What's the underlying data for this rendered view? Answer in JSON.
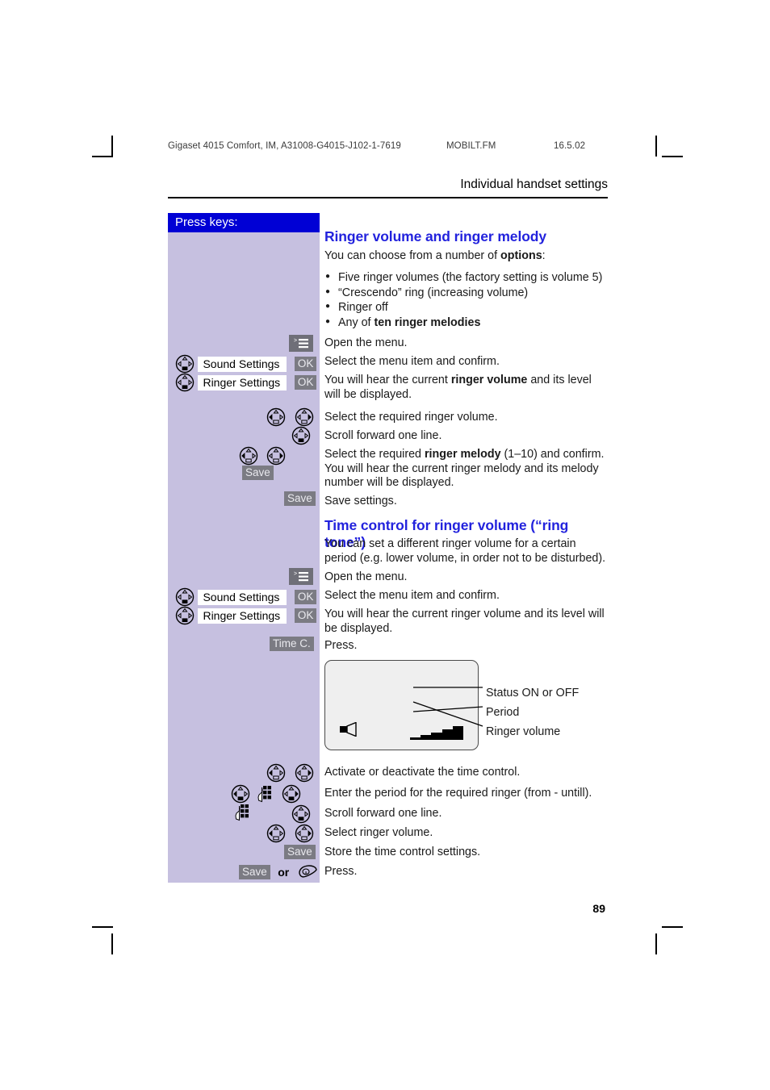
{
  "header": {
    "document_id": "Gigaset 4015 Comfort, IM, A31008-G4015-J102-1-7619",
    "file_name": "MOBILT.FM",
    "date": "16.5.02",
    "chapter_title": "Individual handset settings"
  },
  "sidebar": {
    "title": "Press keys:",
    "labels": {
      "sound_settings": "Sound Settings",
      "ringer_settings": "Ringer Settings",
      "ok": "OK",
      "save": "Save",
      "time_c": "Time C.",
      "or": "or"
    }
  },
  "sections": [
    {
      "heading": "Ringer volume and ringer melody",
      "intro_pre": "You can choose from a number of ",
      "intro_bold": "options",
      "intro_post": ":",
      "options": [
        {
          "pre": "Five ringer volumes (the factory setting is volume 5)",
          "bold": "",
          "post": ""
        },
        {
          "pre": "“Crescendo” ring (increasing volume)",
          "bold": "",
          "post": ""
        },
        {
          "pre": "Ringer off",
          "bold": "",
          "post": ""
        },
        {
          "pre": "Any of ",
          "bold": "ten ringer melodies",
          "post": ""
        }
      ],
      "steps": [
        {
          "pre": "Open the menu.",
          "bold": "",
          "post": ""
        },
        {
          "pre": "Select the menu item and confirm.",
          "bold": "",
          "post": ""
        },
        {
          "pre": "You will hear the current ",
          "bold": "ringer volume",
          "post": " and its level will be displayed."
        },
        {
          "pre": "Select the required ringer volume.",
          "bold": "",
          "post": ""
        },
        {
          "pre": "Scroll forward one line.",
          "bold": "",
          "post": ""
        },
        {
          "pre": "Select the required ",
          "bold": "ringer melody",
          "post": " (1–10) and confirm. You will hear the current ringer melody and its melody number will be displayed."
        },
        {
          "pre": "Save settings.",
          "bold": "",
          "post": ""
        }
      ]
    },
    {
      "heading": "Time control for ringer volume (“ring tone”)",
      "intro_pre": "You can set a different ringer volume for a certain period (e.g. lower volume, in order not to be disturbed).",
      "intro_bold": "",
      "intro_post": "",
      "steps": [
        {
          "pre": "Open the menu.",
          "bold": "",
          "post": ""
        },
        {
          "pre": "Select the menu item and confirm.",
          "bold": "",
          "post": ""
        },
        {
          "pre": "You will hear the current ringer volume and its level will be displayed.",
          "bold": "",
          "post": ""
        },
        {
          "pre": "Press.",
          "bold": "",
          "post": ""
        },
        {
          "pre": "Activate or deactivate the time control.",
          "bold": "",
          "post": ""
        },
        {
          "pre": "Enter the period for the required ringer (from - untill).",
          "bold": "",
          "post": ""
        },
        {
          "pre": "Scroll forward one line.",
          "bold": "",
          "post": ""
        },
        {
          "pre": "Select ringer volume.",
          "bold": "",
          "post": ""
        },
        {
          "pre": "Store the time control settings.",
          "bold": "",
          "post": ""
        },
        {
          "pre": "Press.",
          "bold": "",
          "post": ""
        }
      ]
    }
  ],
  "display_illustration": {
    "callouts": [
      "Status ON or OFF",
      "Period",
      "Ringer volume"
    ]
  },
  "page_number": "89",
  "colors": {
    "sidebar_bg": "#c6c0e0",
    "sidebar_header_bg": "#0000d5",
    "heading": "#2222dd",
    "softkey_bg": "#7b7b83"
  }
}
